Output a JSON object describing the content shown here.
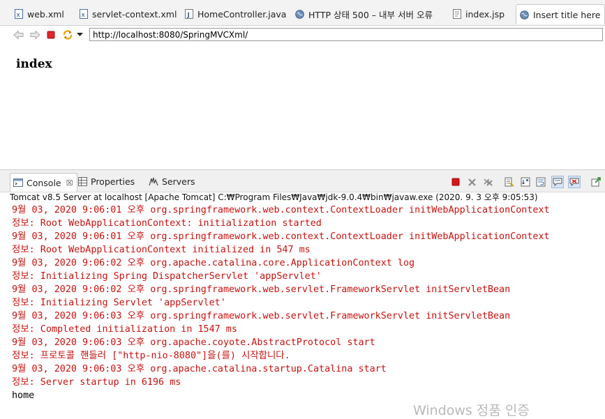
{
  "editor_tabs": [
    {
      "label": "web.xml",
      "icon": "xml-file-icon"
    },
    {
      "label": "servlet-context.xml",
      "icon": "xml-file-icon"
    },
    {
      "label": "HomeController.java",
      "icon": "java-file-icon"
    },
    {
      "label": "HTTP 상태 500 – 내부 서버 오류",
      "icon": "globe-icon"
    },
    {
      "label": "index.jsp",
      "icon": "jsp-file-icon"
    },
    {
      "label": "Insert title here",
      "icon": "globe-icon",
      "active": true
    }
  ],
  "browser": {
    "url": "http://localhost:8080/SpringMVCXml/",
    "heading": "index"
  },
  "view_tabs": [
    {
      "label": "Console",
      "icon": "console-icon",
      "active": true,
      "close": "☒"
    },
    {
      "label": "Properties",
      "icon": "properties-icon"
    },
    {
      "label": "Servers",
      "icon": "servers-icon"
    }
  ],
  "console": {
    "process": "Tomcat v8.5 Server at localhost [Apache Tomcat] C:₩Program Files₩Java₩jdk-9.0.4₩bin₩javaw.exe  (2020. 9. 3 오후 9:05:53)",
    "lines": [
      {
        "text": "9월 03, 2020 9:06:01 오후 org.springframework.web.context.ContextLoader initWebApplicationContext",
        "stream": "err"
      },
      {
        "text": "정보: Root WebApplicationContext: initialization started",
        "stream": "err"
      },
      {
        "text": "9월 03, 2020 9:06:01 오후 org.springframework.web.context.ContextLoader initWebApplicationContext",
        "stream": "err"
      },
      {
        "text": "정보: Root WebApplicationContext initialized in 547 ms",
        "stream": "err"
      },
      {
        "text": "9월 03, 2020 9:06:02 오후 org.apache.catalina.core.ApplicationContext log",
        "stream": "err"
      },
      {
        "text": "정보: Initializing Spring DispatcherServlet 'appServlet'",
        "stream": "err"
      },
      {
        "text": "9월 03, 2020 9:06:02 오후 org.springframework.web.servlet.FrameworkServlet initServletBean",
        "stream": "err"
      },
      {
        "text": "정보: Initializing Servlet 'appServlet'",
        "stream": "err"
      },
      {
        "text": "9월 03, 2020 9:06:03 오후 org.springframework.web.servlet.FrameworkServlet initServletBean",
        "stream": "err"
      },
      {
        "text": "정보: Completed initialization in 1547 ms",
        "stream": "err"
      },
      {
        "text": "9월 03, 2020 9:06:03 오후 org.apache.coyote.AbstractProtocol start",
        "stream": "err"
      },
      {
        "text": "정보: 프로토콜 핸들러 [\"http-nio-8080\"]을(를) 시작합니다.",
        "stream": "err"
      },
      {
        "text": "9월 03, 2020 9:06:03 오후 org.apache.catalina.startup.Catalina start",
        "stream": "err"
      },
      {
        "text": "정보: Server startup in 6196 ms",
        "stream": "err"
      },
      {
        "text": "home",
        "stream": "out"
      }
    ]
  },
  "watermark": "Windows 정품 인증",
  "colors": {
    "stderr": "#c8110e",
    "stdout": "#000000",
    "terminate": "#d7161b"
  }
}
